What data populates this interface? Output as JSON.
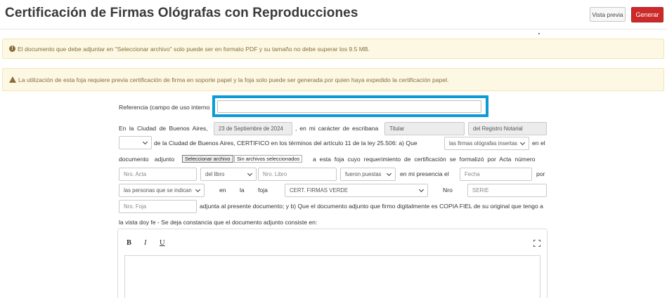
{
  "header": {
    "title": "Certificación de Firmas Ológrafas con Reproducciones",
    "preview_label": "Vista previa",
    "generate_label": "Generar"
  },
  "alerts": {
    "info": "El documento que debe adjuntar en \"Seleccionar archivo\" solo puede ser en formato PDF y su tamaño no debe superar los 9.5 MB.",
    "warning": "La utilización de esta foja requiere previa certificación de firma en soporte papel y la foja solo puede ser generada por quien haya expedido la certificación papel."
  },
  "form": {
    "reference_label": "Referencia (campo de uso interno",
    "reference_value": "",
    "t_city": "En la Ciudad de Buenos Aires,",
    "date": "23 de Septiembre de 2024",
    "t_capacity": ", en mi carácter de escribana",
    "role": "Titular",
    "registry": "del Registro Notarial",
    "t_terms": "de la Ciudad de Buenos Aires, CERTIFICO en los términos del artículo 11 de la ley 25.506: a) Que",
    "signatures_select": "las firmas ológrafas insertas",
    "t_en_el": "en el",
    "t_document": "documento adjunto",
    "file_button": "Seleccionar archivo",
    "file_status": "Sin archivos seleccionados",
    "t_requirement": "a esta foja cuyo requerimiento de certificación se formalizó por Acta número",
    "act_placeholder": "Nro. Acta",
    "book_select": "del libro",
    "book_placeholder": "Nro. Libro",
    "placed_select": "fueron puestas",
    "t_presence": "en mi presencia el",
    "date_placeholder": "Fecha",
    "t_por": "por",
    "persons_select": "las personas que se indican",
    "t_en": "en",
    "t_la": "la",
    "t_foja": "foja",
    "sheet_select": "CERT. FIRMAS VERDE",
    "t_nro": "Nro",
    "serie_placeholder": "SERIE",
    "foja_placeholder": "Nro. Foja",
    "t_attached": "adjunta al presente documento; y b) Que el documento adjunto que firmo digitalmente es COPIA FIEL de su original que tengo a",
    "t_view": "la vista doy fe - Se deja constancia que el documento adjunto consiste en:"
  },
  "editor": {
    "bold": "B",
    "italic": "I",
    "underline": "U",
    "content": ""
  },
  "icons": {
    "info": "info-circle-icon",
    "warning": "warning-triangle-icon",
    "fullscreen": "fullscreen-icon",
    "chevron": "chevron-down-icon"
  },
  "colors": {
    "primary_button": "#cc2a2a",
    "alert_bg": "#fcf8e3",
    "alert_text": "#8a6d3b",
    "highlight": "#0b9bd7"
  }
}
